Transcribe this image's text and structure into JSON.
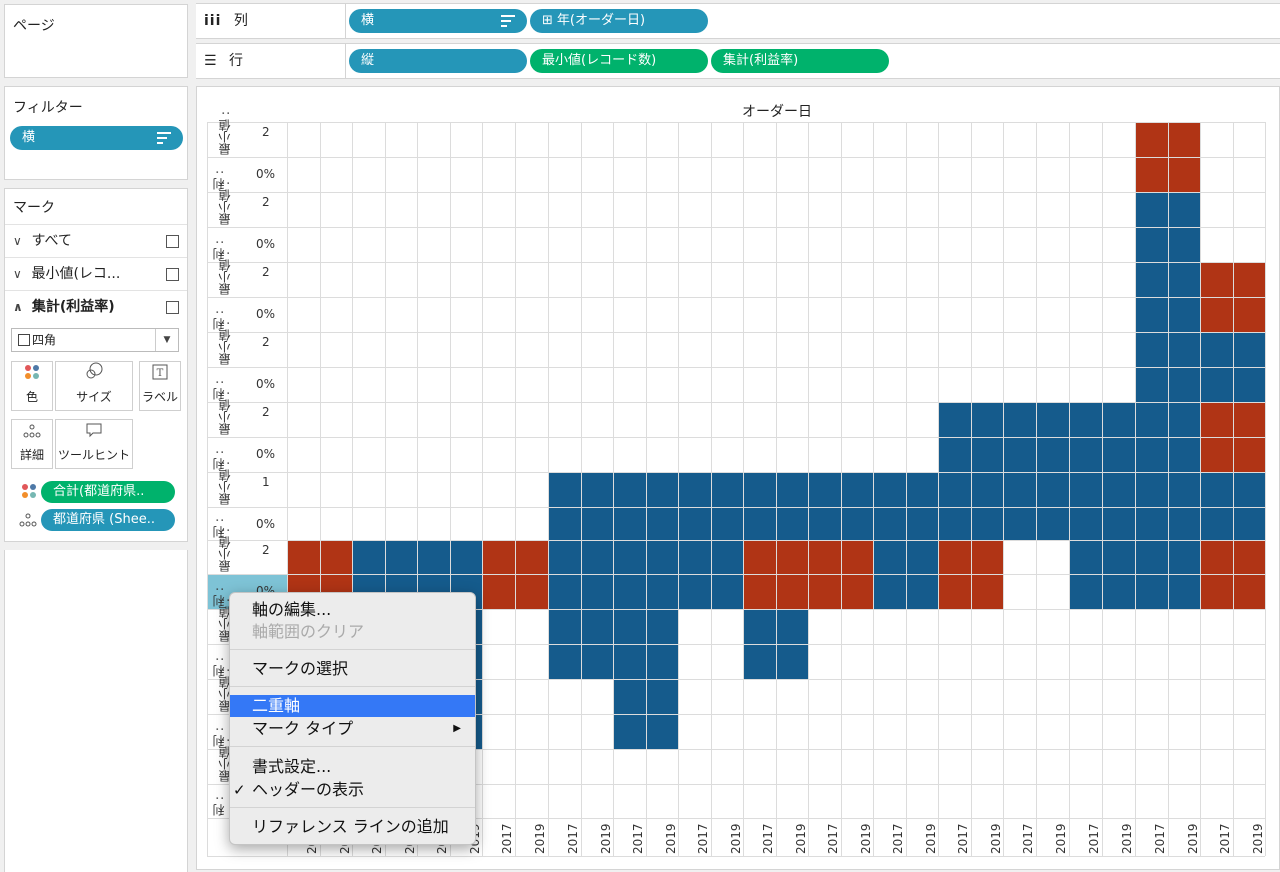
{
  "pages_panel": {
    "title": "ページ"
  },
  "columns_shelf": {
    "icon": "columns-icon",
    "label": "列",
    "pills": [
      "横",
      "年(オーダー日)"
    ],
    "pill2_prefix_icon": "plus-square-icon"
  },
  "rows_shelf": {
    "icon": "rows-icon",
    "label": "行",
    "pills": [
      "縦",
      "最小値(レコード数)",
      "集計(利益率)"
    ]
  },
  "filters_panel": {
    "title": "フィルター",
    "pill": "横"
  },
  "marks_panel": {
    "title": "マーク",
    "rows": [
      "すべて",
      "最小値(レコ...",
      "集計(利益率)"
    ],
    "mark_type": "四角",
    "buttons": {
      "color": "色",
      "size": "サイズ",
      "label": "ラベル",
      "detail": "詳細",
      "tooltip": "ツールヒント"
    },
    "field_pills": [
      "合計(都道府県..",
      "都道府県 (Shee.."
    ]
  },
  "view": {
    "header_title": "オーダー日",
    "row_header_min": "最小値 :",
    "row_header_profit": "利 :",
    "row_values": [
      {
        "min": "2",
        "pct": "0%"
      },
      {
        "min": "2",
        "pct": "0%"
      },
      {
        "min": "2",
        "pct": "0%"
      },
      {
        "min": "2",
        "pct": "0%"
      },
      {
        "min": "2",
        "pct": "0%"
      },
      {
        "min": "1",
        "pct": "0%"
      },
      {
        "min": "2",
        "pct": "0%"
      }
    ],
    "year_labels": [
      "2017",
      "2019"
    ],
    "colors": {
      "blue": "#155b8c",
      "red": "#b03415",
      "grid": "#dcdcdc",
      "highlight": "#7ec3d6"
    }
  },
  "context_menu": {
    "items": [
      "軸の編集...",
      "軸範囲のクリア",
      "マークの選択",
      "二重軸",
      "マーク タイプ",
      "書式設定...",
      "ヘッダーの表示",
      "リファレンス ラインの追加"
    ],
    "submenu_arrow": "▶",
    "checkmark": "✓"
  }
}
